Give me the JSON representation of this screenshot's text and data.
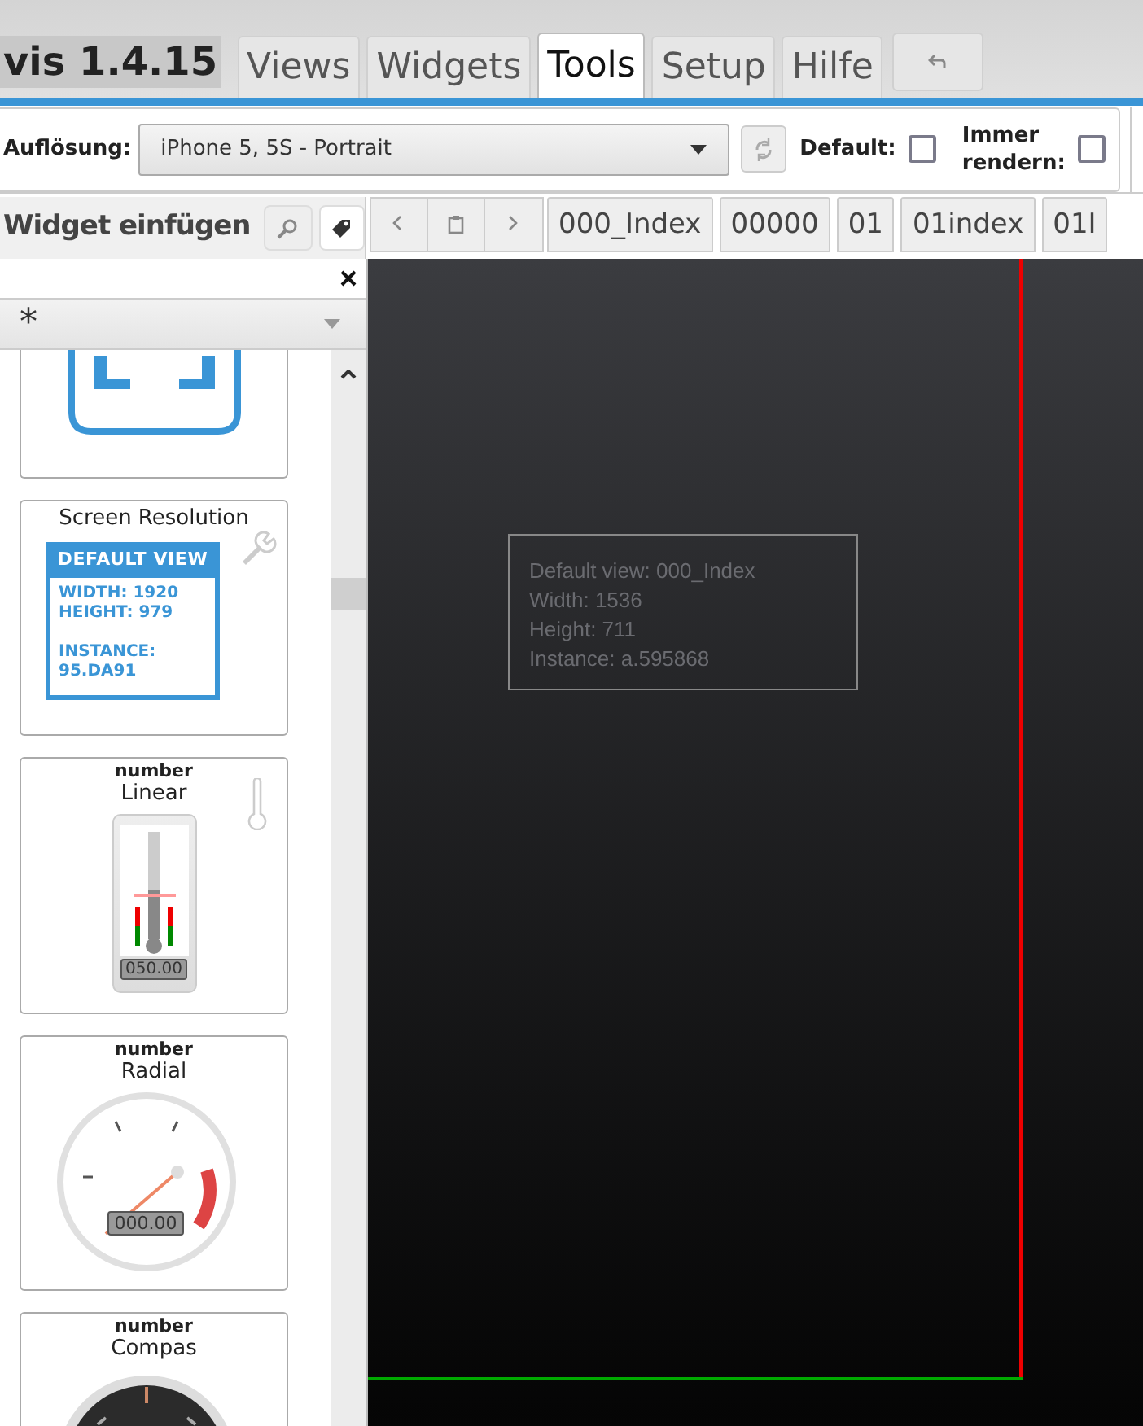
{
  "app_title": "vis 1.4.15",
  "menu_tabs": [
    {
      "label": "Views",
      "selected": false
    },
    {
      "label": "Widgets",
      "selected": false
    },
    {
      "label": "Tools",
      "selected": true
    },
    {
      "label": "Setup",
      "selected": false
    },
    {
      "label": "Hilfe",
      "selected": false
    }
  ],
  "toolbar": {
    "resolution_label": "Auflösung:",
    "resolution_value": "iPhone 5, 5S - Portrait",
    "default_label": "Default:",
    "default_checked": false,
    "render_label": "Immer rendern:",
    "render_checked": false
  },
  "widget_panel": {
    "title": "Widget einfügen",
    "filter_value": "*",
    "widgets": [
      {
        "kind": "frame"
      },
      {
        "kind": "resolution",
        "title": "Screen Resolution",
        "preview_header": "DEFAULT VIEW",
        "preview_lines": [
          "WIDTH: 1920",
          "HEIGHT: 979"
        ],
        "preview_instance": [
          "INSTANCE:",
          "95.DA91"
        ]
      },
      {
        "kind": "linear",
        "set": "number",
        "title": "Linear",
        "readout": "050.00"
      },
      {
        "kind": "radial",
        "set": "number",
        "title": "Radial",
        "readout": "000.00"
      },
      {
        "kind": "compass",
        "set": "number",
        "title": "Compas"
      }
    ]
  },
  "view_tabs": [
    {
      "label": "000_Index"
    },
    {
      "label": "00000"
    },
    {
      "label": "01"
    },
    {
      "label": "01index"
    },
    {
      "label": "01I"
    }
  ],
  "canvas": {
    "info_lines": [
      "Default view: 000_Index",
      "Width: 1536",
      "Height: 711",
      "Instance: a.595868"
    ]
  }
}
